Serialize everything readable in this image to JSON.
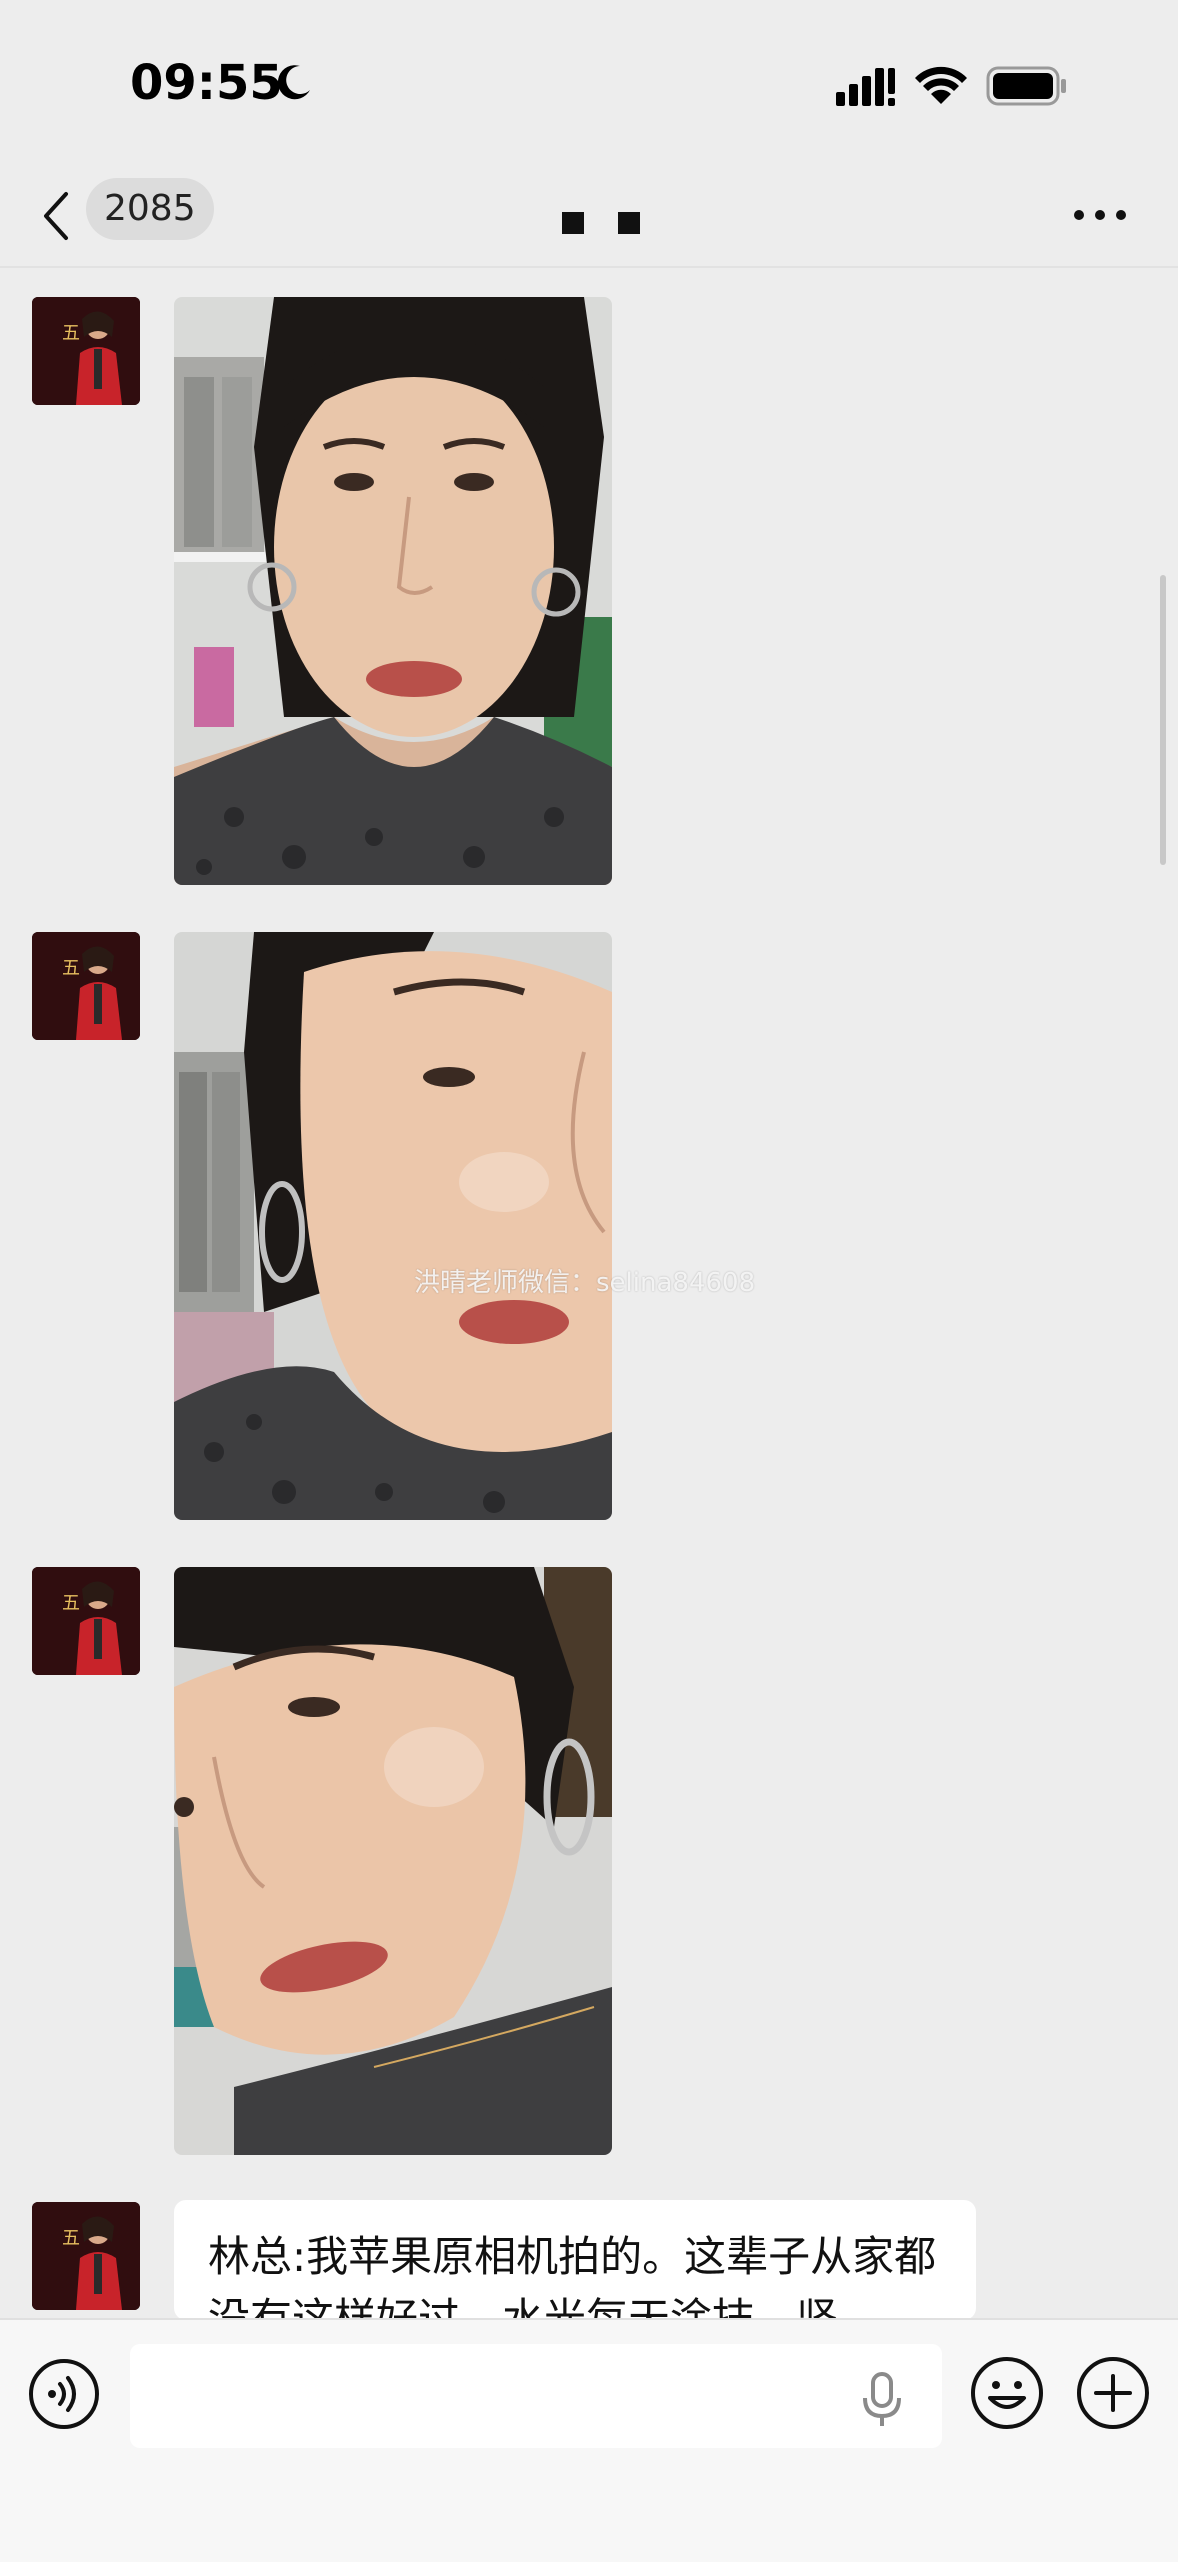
{
  "status_bar": {
    "time": "09:55",
    "icons": [
      "moon-icon",
      "cellular-signal-icon",
      "wifi-icon",
      "battery-icon"
    ]
  },
  "nav": {
    "unread_count": "2085",
    "icons": [
      "back-icon",
      "more-icon"
    ]
  },
  "messages": [
    {
      "type": "image",
      "sender": "avatar",
      "subject": "selfie-front"
    },
    {
      "type": "image",
      "sender": "avatar",
      "subject": "selfie-three-quarter"
    },
    {
      "type": "image",
      "sender": "avatar",
      "subject": "selfie-profile"
    },
    {
      "type": "text",
      "sender": "avatar",
      "text": "林总:我苹果原相机拍的。这辈子从家都没有这样好过，水光每天涂抹，坚"
    }
  ],
  "watermark": "洪晴老师微信：selina84608",
  "input_bar": {
    "value": "",
    "placeholder": "",
    "icons": [
      "voice-icon",
      "microphone-icon",
      "emoji-icon",
      "plus-icon"
    ]
  },
  "colors": {
    "background": "#ededed",
    "bubble": "#ffffff",
    "input_bar": "#f7f7f7"
  }
}
